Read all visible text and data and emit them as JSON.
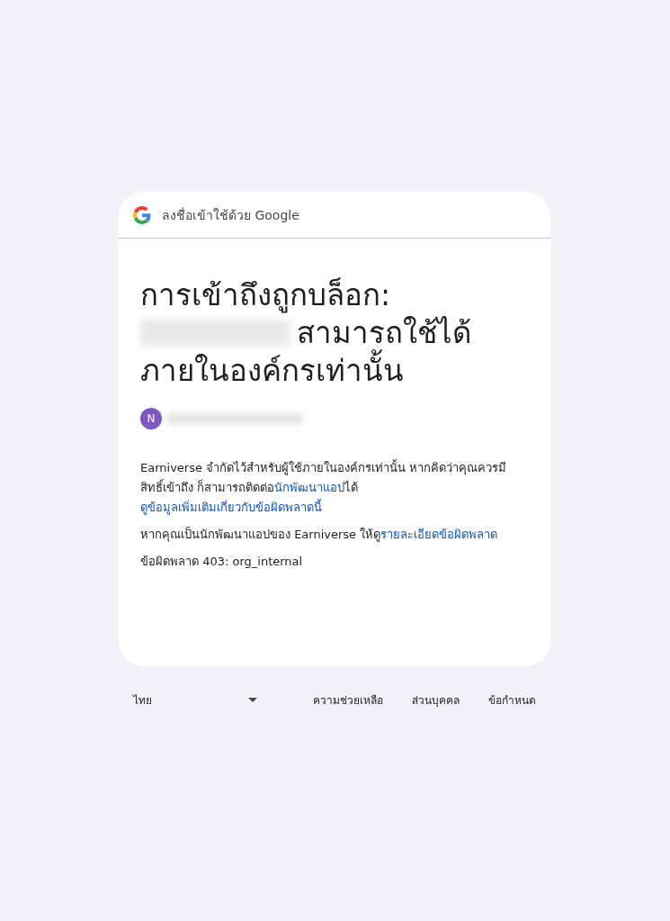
{
  "header": {
    "title": "ลงชื่อเข้าใช้ด้วย Google"
  },
  "heading": {
    "line_1": "การเข้าถึงถูกบล็อก:",
    "line_2": "สามารถใช้ได้",
    "line_3": "ภายในองค์กรเท่านั้น"
  },
  "account": {
    "initial": "N",
    "color": "#7e57c2"
  },
  "paragraphs": [
    {
      "parts": [
        {
          "kind": "text",
          "text": "Earniverse จำกัดไว้สำหรับผู้ใช้ภายในองค์กรเท่านั้น หากคิดว่าคุณควรมีสิทธิ์เข้าถึง ก็สามารถติดต่อ"
        },
        {
          "kind": "link",
          "text": "นักพัฒนาแอป"
        },
        {
          "kind": "text",
          "text": "ได้ "
        },
        {
          "kind": "link",
          "text": "ดูข้อมูลเพิ่มเติมเกี่ยวกับข้อผิดพลาดนี้"
        }
      ]
    },
    {
      "parts": [
        {
          "kind": "text",
          "text": "หากคุณเป็นนักพัฒนาแอปของ Earniverse ให้ดู"
        },
        {
          "kind": "link",
          "text": "รายละเอียดข้อผิดพลาด"
        }
      ]
    },
    {
      "parts": [
        {
          "kind": "text",
          "text": "ข้อผิดพลาด 403: org_internal"
        }
      ]
    }
  ],
  "footer": {
    "language": "ไทย",
    "links": [
      "ความช่วยเหลือ",
      "ส่วนบุคคล",
      "ข้อกำหนด"
    ]
  }
}
